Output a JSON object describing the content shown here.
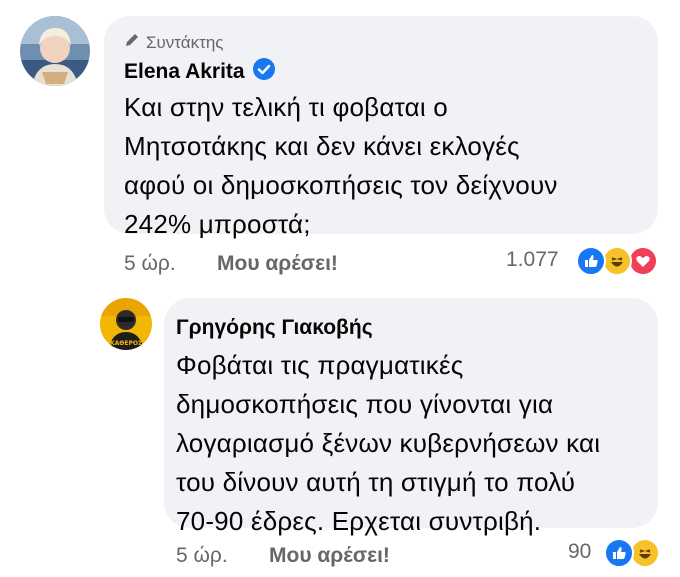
{
  "comment": {
    "role_label": "Συντάκτης",
    "author": "Elena Akrita",
    "text": "Και στην τελική τι φοβαται ο\nΜητσοτάκης και δεν κάνει εκλογές\nαφού οι δημοσκοπήσεις τον δείχνουν\n242% μπροστά;",
    "time": "5 ώρ.",
    "like_label": "Μου αρέσει!",
    "reaction_count": "1.077",
    "reactions": [
      "like-icon",
      "haha-icon",
      "love-icon"
    ]
  },
  "reply": {
    "author": "Γρηγόρης Γιακοβής",
    "text": "Φοβάται τις πραγματικές\nδημοσκοπήσεις που γίνονται για\nλογαριασμό ξένων κυβερνήσεων και\nτου δίνουν αυτή τη στιγμή το πολύ\n70-90 έδρες. Ερχεται συντριβή.",
    "time": "5 ώρ.",
    "like_label": "Μου αρέσει!",
    "reaction_count": "90",
    "reactions": [
      "like-icon",
      "haha-icon"
    ],
    "avatar_text": "ΚΑΘΕΡΟΣ"
  },
  "colors": {
    "bubble": "#f0f2f5",
    "meta": "#65676b",
    "verified": "#1877f2",
    "like": "#1877f2",
    "haha": "#f7c12a",
    "love": "#f33e58"
  }
}
